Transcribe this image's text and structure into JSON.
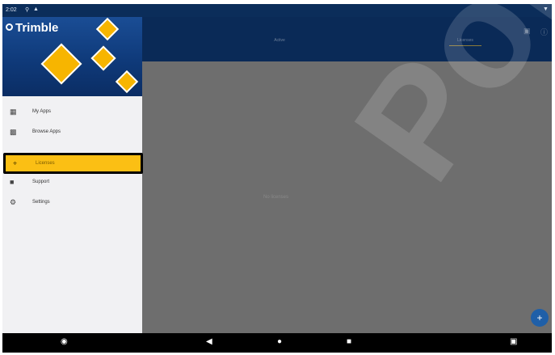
{
  "status_bar": {
    "time": "2:02"
  },
  "brand": {
    "logo_text": "Trimble"
  },
  "tabs": [
    {
      "label": "Active"
    },
    {
      "label": "Licenses"
    }
  ],
  "drawer": {
    "items": [
      {
        "label": "My Apps",
        "icon": "grid-icon"
      },
      {
        "label": "Browse Apps",
        "icon": "browse-grid-icon"
      },
      {
        "label": "Licenses",
        "icon": "license-icon",
        "selected": true
      },
      {
        "label": "Support",
        "icon": "support-icon"
      },
      {
        "label": "Settings",
        "icon": "gear-icon"
      }
    ]
  },
  "content": {
    "message": "No licenses",
    "watermark": "Point"
  },
  "colors": {
    "header": "#0a2a57",
    "accent": "#fbbf14",
    "fab": "#1f5fa8"
  }
}
